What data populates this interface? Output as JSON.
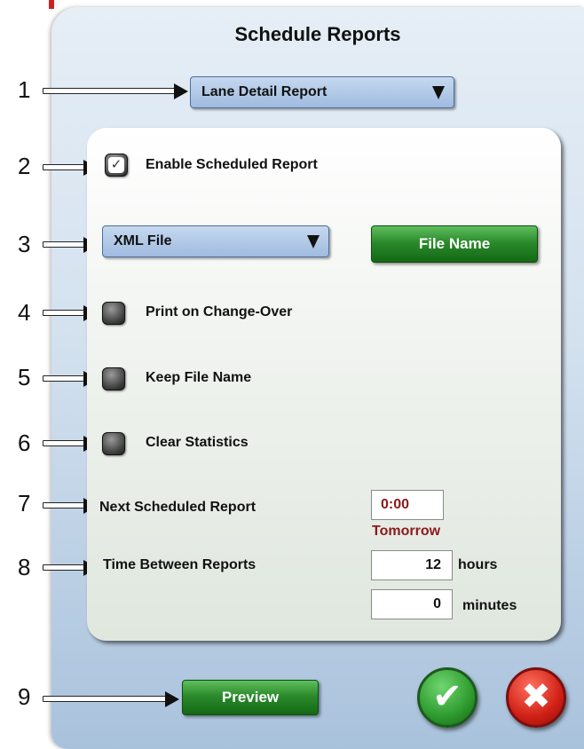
{
  "dialog": {
    "title": "Schedule Reports"
  },
  "annotations": [
    "1",
    "2",
    "3",
    "4",
    "5",
    "6",
    "7",
    "8",
    "9"
  ],
  "report_select": {
    "value": "Lane Detail Report"
  },
  "enable_scheduled": {
    "label": "Enable Scheduled Report",
    "checked": true,
    "tick": "✓"
  },
  "file_type_select": {
    "value": "XML File"
  },
  "file_name_button": {
    "label": "File Name"
  },
  "print_on_changeover": {
    "label": "Print on Change-Over",
    "checked": false
  },
  "keep_file_name": {
    "label": "Keep File Name",
    "checked": false
  },
  "clear_statistics": {
    "label": "Clear Statistics",
    "checked": false
  },
  "next_report": {
    "label": "Next Scheduled Report",
    "time": "0:00",
    "day": "Tomorrow",
    "color": "#8b1a1a"
  },
  "time_between": {
    "label": "Time Between Reports",
    "hours_value": "12",
    "hours_unit": "hours",
    "minutes_value": "0",
    "minutes_unit": "minutes"
  },
  "preview_button": {
    "label": "Preview"
  },
  "ok_button": {
    "glyph": "✔",
    "icon": "check-icon",
    "color": "#2e9a2e"
  },
  "cancel_button": {
    "glyph": "✖",
    "icon": "x-icon",
    "color": "#d02015"
  }
}
